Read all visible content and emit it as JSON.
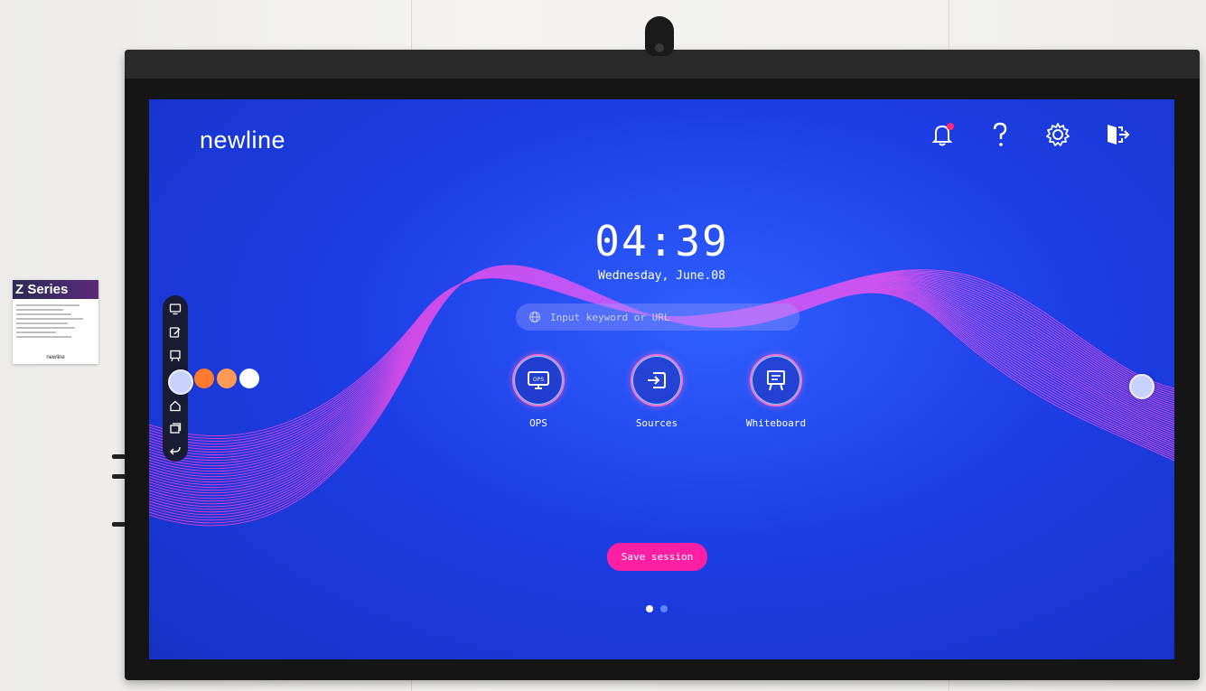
{
  "placard": {
    "title": "Z Series",
    "brand": "newline"
  },
  "screen": {
    "brand": "newline",
    "top_icons": [
      {
        "icon": "bell-icon",
        "has_notification": true
      },
      {
        "icon": "help-icon",
        "label": "?"
      },
      {
        "icon": "gear-icon"
      },
      {
        "icon": "exit-icon"
      }
    ],
    "clock": "04:39",
    "date": "Wednesday, June.08",
    "search": {
      "placeholder": "Input keyword or URL",
      "icon": "globe-icon"
    },
    "apps": [
      {
        "label": "OPS",
        "icon": "ops-monitor-icon"
      },
      {
        "label": "Sources",
        "icon": "input-source-icon"
      },
      {
        "label": "Whiteboard",
        "icon": "whiteboard-icon"
      }
    ],
    "save_label": "Save session",
    "pages": {
      "total": 2,
      "active": 1
    },
    "sidebar": [
      "ops-icon",
      "annotate-icon",
      "whiteboard-icon",
      "home-icon",
      "windows-icon",
      "back-icon"
    ],
    "colors": {
      "accent_pink": "#ff1fa5",
      "screen_blue": "#1d3ee6",
      "ring": "#ff6fd0"
    }
  }
}
